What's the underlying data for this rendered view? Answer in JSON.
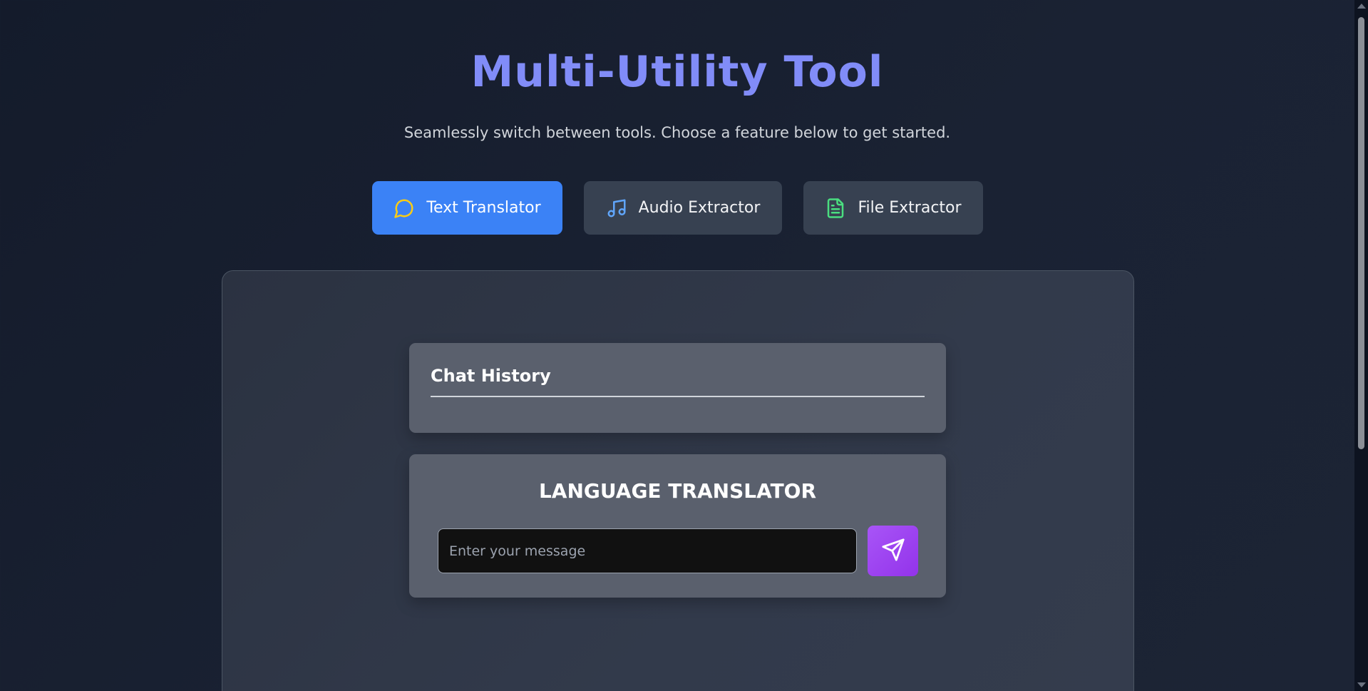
{
  "header": {
    "title": "Multi-Utility Tool",
    "subtitle": "Seamlessly switch between tools. Choose a feature below to get started."
  },
  "tabs": [
    {
      "label": "Text Translator",
      "icon": "chat-bubble-icon",
      "active": true,
      "icon_color": "#facc15"
    },
    {
      "label": "Audio Extractor",
      "icon": "music-note-icon",
      "active": false,
      "icon_color": "#60a5fa"
    },
    {
      "label": "File Extractor",
      "icon": "document-icon",
      "active": false,
      "icon_color": "#4ade80"
    }
  ],
  "history": {
    "title": "Chat History"
  },
  "translator": {
    "title": "LANGUAGE TRANSLATOR",
    "input_value": "",
    "input_placeholder": "Enter your message",
    "send_icon": "send-icon"
  },
  "colors": {
    "accent": "#818cf8",
    "active_tab": "#3b82f6",
    "send_button": "#a855f7"
  }
}
